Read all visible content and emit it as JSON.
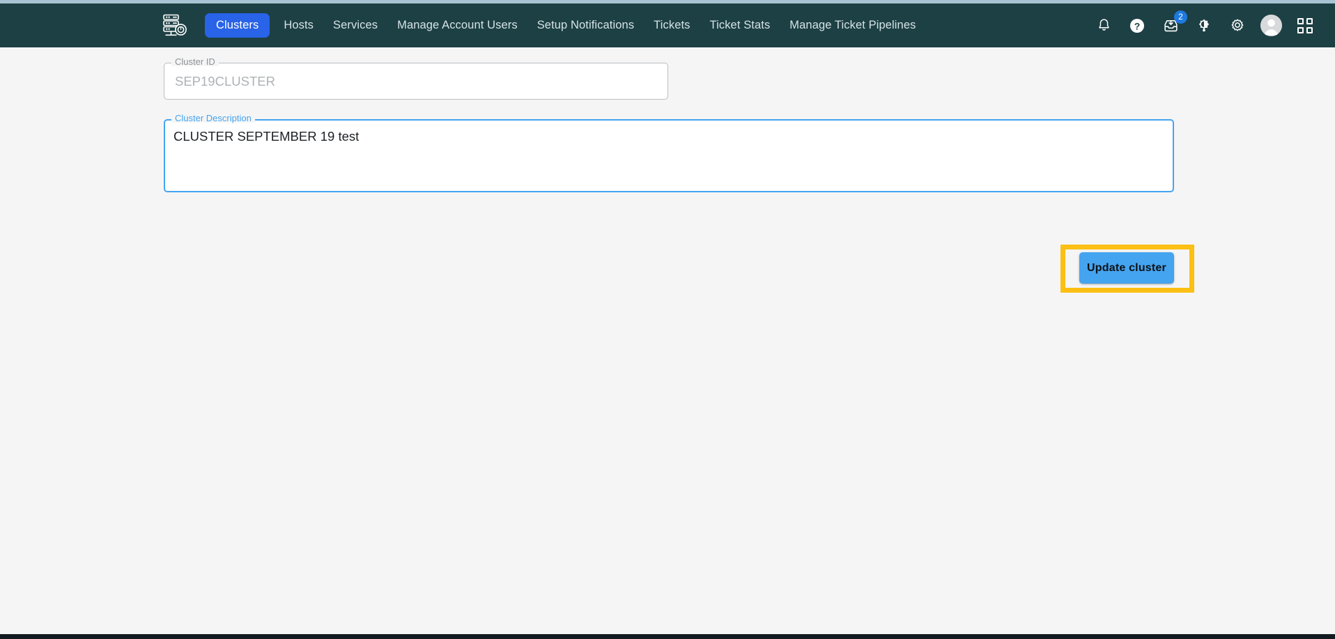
{
  "app": {
    "logo_icon": "server-stack-clock-icon",
    "header_bg": "#1d4044",
    "accent_blue": "#2863e8",
    "button_blue": "#44a4f0",
    "highlight_color": "#fcbf13"
  },
  "nav": {
    "items": [
      {
        "label": "Clusters",
        "active": true
      },
      {
        "label": "Hosts",
        "active": false
      },
      {
        "label": "Services",
        "active": false
      },
      {
        "label": "Manage Account Users",
        "active": false
      },
      {
        "label": "Setup Notifications",
        "active": false
      },
      {
        "label": "Tickets",
        "active": false
      },
      {
        "label": "Ticket Stats",
        "active": false
      },
      {
        "label": "Manage Ticket Pipelines",
        "active": false
      }
    ]
  },
  "toolbar_icons": {
    "notifications": {
      "icon": "bell-icon"
    },
    "help": {
      "icon": "help-circle-icon"
    },
    "inbox": {
      "icon": "inbox-download-icon",
      "badge": "2"
    },
    "theme": {
      "icon": "brightness-contrast-icon"
    },
    "settings": {
      "icon": "gear-icon"
    },
    "account": {
      "icon": "avatar-icon"
    },
    "apps": {
      "icon": "apps-grid-icon"
    }
  },
  "form": {
    "cluster_id": {
      "label": "Cluster ID",
      "value": "SEP19CLUSTER",
      "placeholder": "Cluster ID",
      "disabled": true
    },
    "cluster_description": {
      "label": "Cluster Description",
      "value": "CLUSTER SEPTEMBER 19 test",
      "placeholder": "Cluster Description",
      "focused": true
    },
    "update_button": {
      "label": "Update cluster"
    }
  }
}
